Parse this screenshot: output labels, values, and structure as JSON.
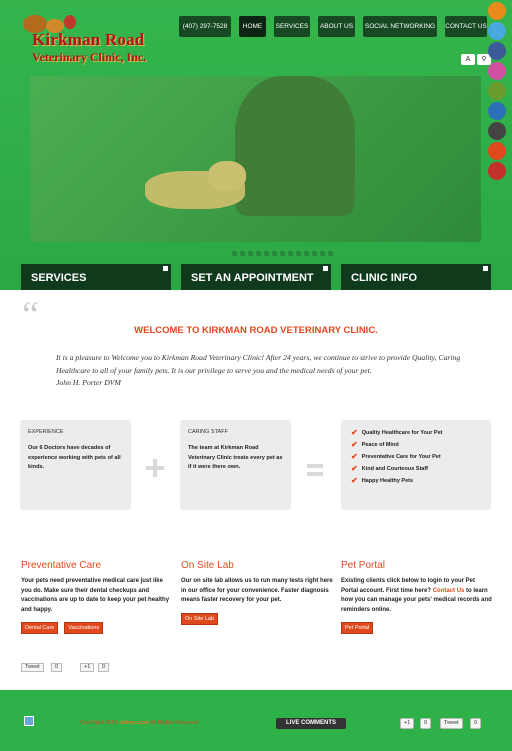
{
  "header": {
    "logo_line1": "Kirkman Road",
    "logo_line2": "Veterinary Clinic, Inc.",
    "phone": "(407) 297-7528",
    "nav": [
      "HOME",
      "SERVICES",
      "ABOUT US",
      "SOCIAL NETWORKING",
      "CONTACT US"
    ],
    "tools": [
      "A",
      "A"
    ]
  },
  "bars": [
    "SERVICES",
    "SET AN APPOINTMENT",
    "CLINIC INFO"
  ],
  "welcome": {
    "quote_mark": "“",
    "title": "WELCOME TO KIRKMAN ROAD VETERINARY CLINIC.",
    "text": "It is a pleasure to Welcome you to Kirkman Road Veterinary Clinic! After 24 years, we continue to strive to provide Quality, Caring Healthcare to all of your family pets. It is our privilege to serve you and the medical needs of your pet.",
    "signature": "John H. Porter DVM"
  },
  "boxes": {
    "experience": {
      "title": "EXPERIENCE",
      "text": "Our 6 Doctors have decades of experience working with pets of all kinds."
    },
    "staff": {
      "title": "CARING STAFF",
      "text": "The team at Kirkman Road Veterinary Clinic treats every pet as if it were there own."
    },
    "checklist": [
      "Quality Healthcare for Your Pet",
      "Peace of Mind",
      "Preventative Care for Your Pet",
      "Kind and Courteous Staff",
      "Happy Healthy Pets"
    ]
  },
  "columns": [
    {
      "heading": "Preventative Care",
      "text": "Your pets need preventative medical care just like you do. Make sure their dental checkups and vaccinations are up to date to keep your pet healthy and happy.",
      "buttons": [
        "Dental Care",
        "Vaccinations"
      ]
    },
    {
      "heading": "On Site Lab",
      "text": "Our on site lab allows us to run many tests right here in our office for your convenience. Faster diagnosis means faster recovery for your pet.",
      "buttons": [
        "On Site Lab"
      ]
    },
    {
      "heading": "Pet Portal",
      "text": "Existing clients click below to login to your Pet Portal account. First time here?",
      "link": "Contact Us",
      "text2": "to learn how you can manage your pets' medical records and reminders online.",
      "buttons": [
        "Pet Portal"
      ]
    }
  ],
  "share": {
    "tweet": "Tweet",
    "tweet_count": "0",
    "gplus": "+1",
    "gplus_count": "0"
  },
  "footer": {
    "copyright": "Copyright 2012",
    "site": "vetlive.com",
    "rights": "All Rights Reserved",
    "live_comments": "LIVE COMMENTS",
    "gplus": "+1",
    "gplus_count": "0",
    "tweet": "Tweet",
    "tweet_count": "0"
  },
  "colors": {
    "green": "#2fb14a",
    "dark": "#0f3a1b",
    "accent": "#e0491e"
  },
  "social_icons": [
    "rss-icon",
    "twitter-icon",
    "facebook-icon",
    "flickr-icon",
    "digg-icon",
    "delicious-icon",
    "myspace-icon",
    "stumbleupon-icon",
    "youtube-icon"
  ]
}
